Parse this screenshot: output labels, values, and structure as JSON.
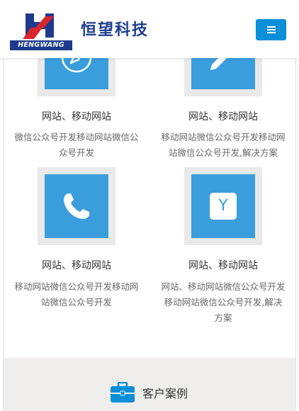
{
  "header": {
    "brand_name": "恒望科技",
    "logo_caption": "HENGWANG",
    "menu_icon": "menu-icon",
    "accent_color": "#0a8fd8"
  },
  "cards": [
    {
      "icon": "compass-icon",
      "title": "网站、移动网站",
      "desc_line1": "微信公众号开发移动网站微信公",
      "desc_line2": "众号开发"
    },
    {
      "icon": "pencil-icon",
      "title": "网站、移动网站",
      "desc_line1": "移动网站微信公众号开发移动网",
      "desc_line2": "站微信公众号开发,解决方案"
    },
    {
      "icon": "phone-icon",
      "title": "网站、移动网站",
      "desc_line1": "移动网站微信公众号开发移动网",
      "desc_line2": "站微信公众号开发"
    },
    {
      "icon": "y-icon",
      "icon_text": "Y",
      "title": "网站、移动网站",
      "desc_line1": "网站、移动网站微信公众号开发",
      "desc_line2": "移动网站微信公众号开发,解决",
      "desc_line3": "方案"
    }
  ],
  "section": {
    "icon": "briefcase-icon",
    "title": "客户案例",
    "icon_color": "#0a8fd8"
  },
  "colors": {
    "tile": "#3a9edd",
    "tile_border": "#e9e9e9",
    "section_bg": "#efeeec"
  }
}
